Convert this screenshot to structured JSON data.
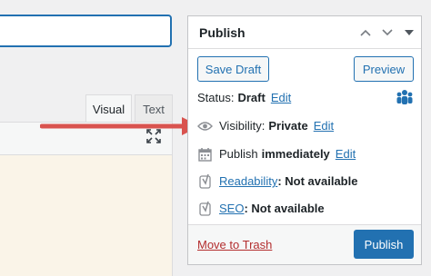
{
  "editor": {
    "tab_visual": "Visual",
    "tab_text": "Text"
  },
  "publish": {
    "title": "Publish",
    "save_draft": "Save Draft",
    "preview": "Preview",
    "status_label": "Status:",
    "status_value": "Draft",
    "status_edit": "Edit",
    "visibility_label": "Visibility:",
    "visibility_value": "Private",
    "visibility_edit": "Edit",
    "publish_label": "Publish",
    "publish_value": "immediately",
    "publish_edit": "Edit",
    "readability_link": "Readability",
    "readability_value": ": Not available",
    "seo_link": "SEO",
    "seo_value": ": Not available",
    "trash": "Move to Trash",
    "publish_button": "Publish"
  },
  "colors": {
    "accent": "#2271b1",
    "trash": "#b32d2e",
    "arrow": "#d9534f"
  }
}
